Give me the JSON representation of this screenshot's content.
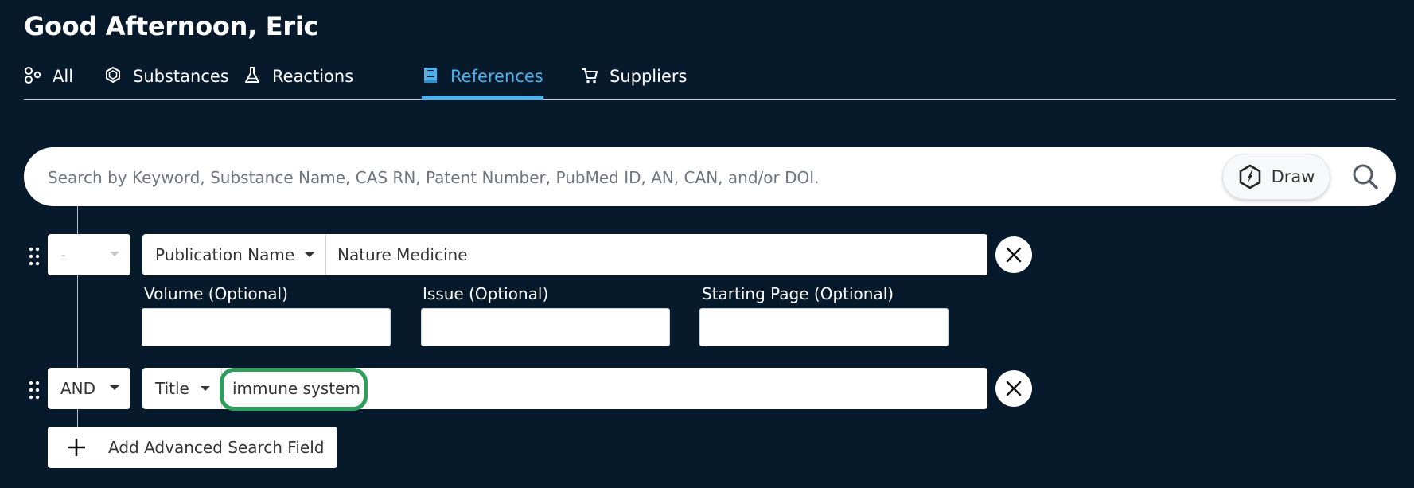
{
  "greeting": "Good Afternoon, Eric",
  "tabs": [
    {
      "label": "All",
      "icon": "all-icon",
      "active": false
    },
    {
      "label": "Substances",
      "icon": "hexagon-icon",
      "active": false
    },
    {
      "label": "Reactions",
      "icon": "flask-icon",
      "active": false
    },
    {
      "label": "References",
      "icon": "book-icon",
      "active": true
    },
    {
      "label": "Suppliers",
      "icon": "cart-icon",
      "active": false
    }
  ],
  "search": {
    "placeholder": "Search by Keyword, Substance Name, CAS RN, Patent Number, PubMed ID, AN, CAN, and/or DOI.",
    "draw_label": "Draw"
  },
  "advanced_fields": [
    {
      "operator": "-",
      "field_type": "Publication Name",
      "value": "Nature Medicine",
      "sub_fields": [
        {
          "label": "Volume (Optional)",
          "value": ""
        },
        {
          "label": "Issue (Optional)",
          "value": ""
        },
        {
          "label": "Starting Page (Optional)",
          "value": ""
        }
      ]
    },
    {
      "operator": "AND",
      "field_type": "Title",
      "value": "immune system"
    }
  ],
  "add_field_label": "Add Advanced Search Field",
  "colors": {
    "background": "#071a2c",
    "accent": "#4cb3ee",
    "highlight": "#2e9c5a"
  }
}
